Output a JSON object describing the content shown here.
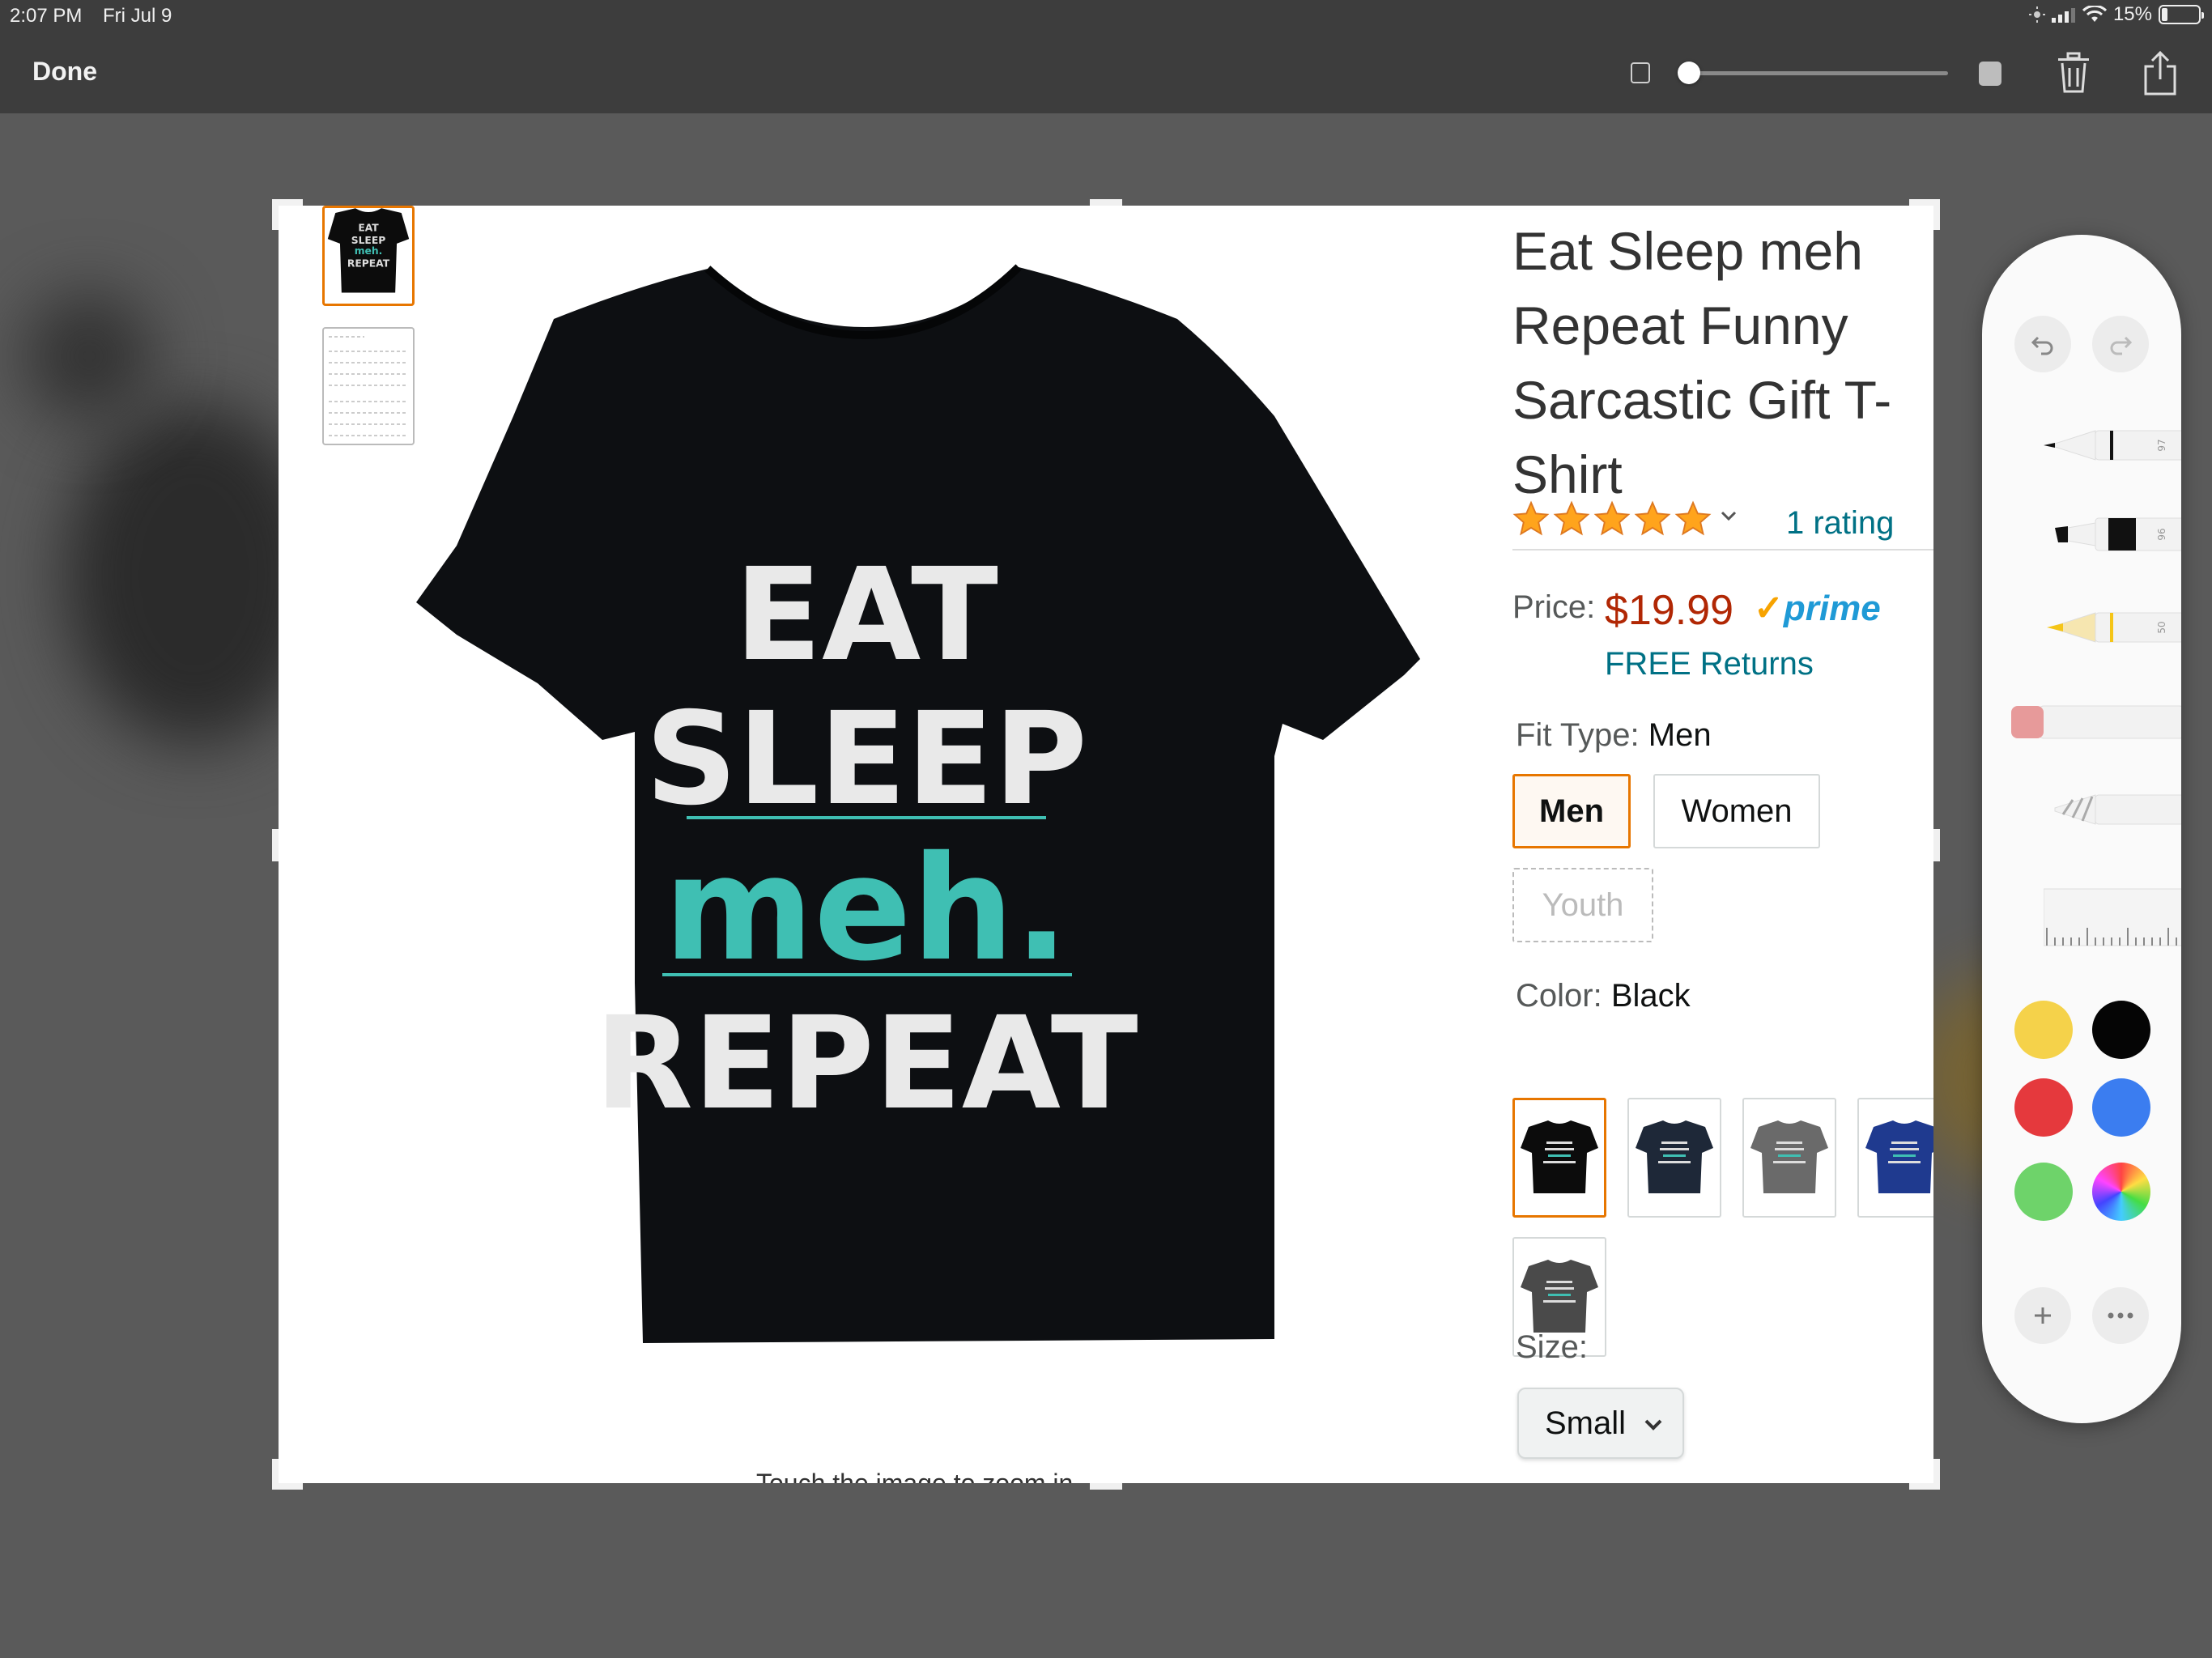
{
  "status_bar": {
    "time": "2:07 PM",
    "date": "Fri Jul 9",
    "battery_text": "15%",
    "battery_level": 0.15
  },
  "toolbar": {
    "done_label": "Done",
    "icons": [
      "small-square-icon",
      "opacity-slider",
      "large-square-icon",
      "trash-icon",
      "share-icon"
    ]
  },
  "product": {
    "title": "Eat Sleep meh Repeat Funny Sarcastic Gift T-Shirt",
    "rating_stars": 5,
    "rating_text": "1 rating",
    "price_label": "Price:",
    "price": "$19.99",
    "prime_label": "prime",
    "free_returns": "FREE Returns",
    "fit_type_label": "Fit Type:",
    "fit_type_value": "Men",
    "fit_options": [
      {
        "label": "Men",
        "state": "selected"
      },
      {
        "label": "Women",
        "state": "available"
      },
      {
        "label": "Youth",
        "state": "unavailable"
      }
    ],
    "color_label": "Color:",
    "color_value": "Black",
    "color_swatches": [
      {
        "name": "Black",
        "hex": "#0c0c0c",
        "selected": true
      },
      {
        "name": "Navy",
        "hex": "#1e2838",
        "selected": false
      },
      {
        "name": "Gray",
        "hex": "#6a6a6a",
        "selected": false
      },
      {
        "name": "Royal Blue",
        "hex": "#1f3a8f",
        "selected": false
      },
      {
        "name": "Dark Heather",
        "hex": "#4a4a4a",
        "selected": false
      }
    ],
    "size_label": "Size:",
    "size_value": "Small",
    "zoom_hint": "Touch the image to zoom in",
    "shirt_text": {
      "line1": "EAT",
      "line2": "SLEEP",
      "line3": "meh.",
      "line4": "REPEAT"
    }
  },
  "palette": {
    "tool_widths": [
      "97",
      "96",
      "50"
    ],
    "colors": [
      "#f5d24a",
      "#050505",
      "#e5393d",
      "#3b7df0",
      "#6ed36a"
    ],
    "icons": [
      "undo-icon",
      "redo-icon",
      "pen-icon",
      "marker-icon",
      "pencil-icon",
      "eraser-icon",
      "lasso-icon",
      "ruler-icon",
      "color-wheel-icon",
      "add-icon",
      "more-icon"
    ]
  },
  "colors": {
    "accent_orange": "#e77600",
    "price_red": "#b12704",
    "link_teal": "#007185",
    "prime_blue": "#1f9ad6",
    "shirt_accent": "#3fbfb3"
  }
}
